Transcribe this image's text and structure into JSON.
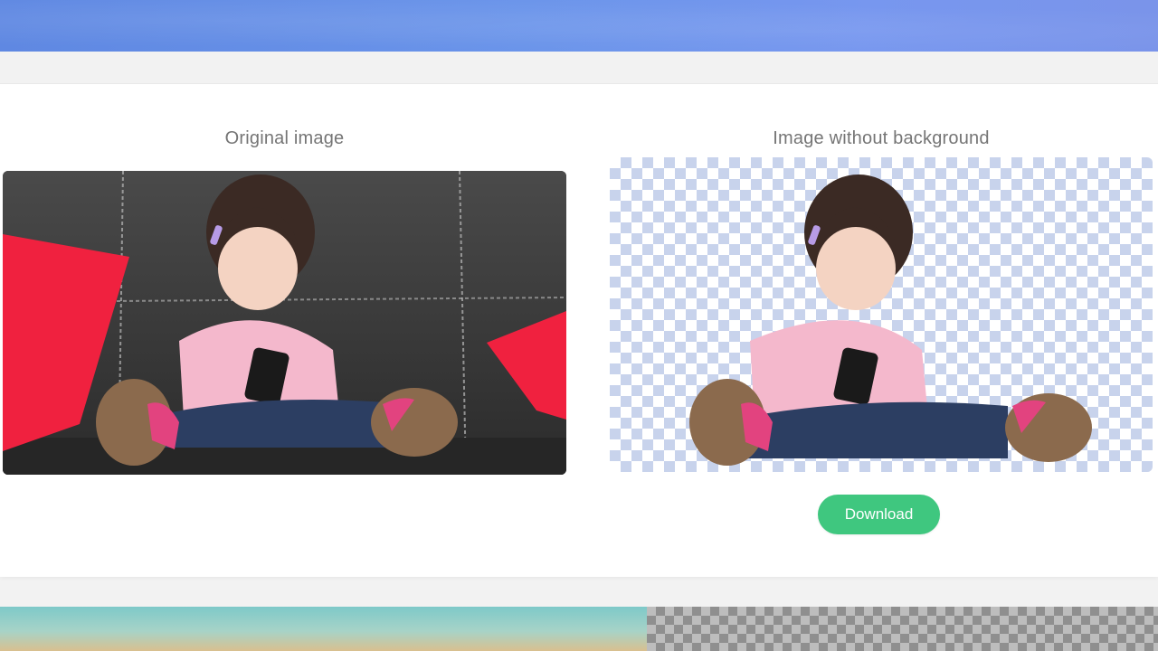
{
  "comparison": {
    "original_title": "Original image",
    "result_title": "Image without background",
    "download_label": "Download"
  },
  "colors": {
    "banner": "#6a94ea",
    "download_button": "#3fc77f",
    "checker": "#c8d3ec",
    "sofa": "#3a3a3a",
    "pillow": "#f0213f"
  }
}
